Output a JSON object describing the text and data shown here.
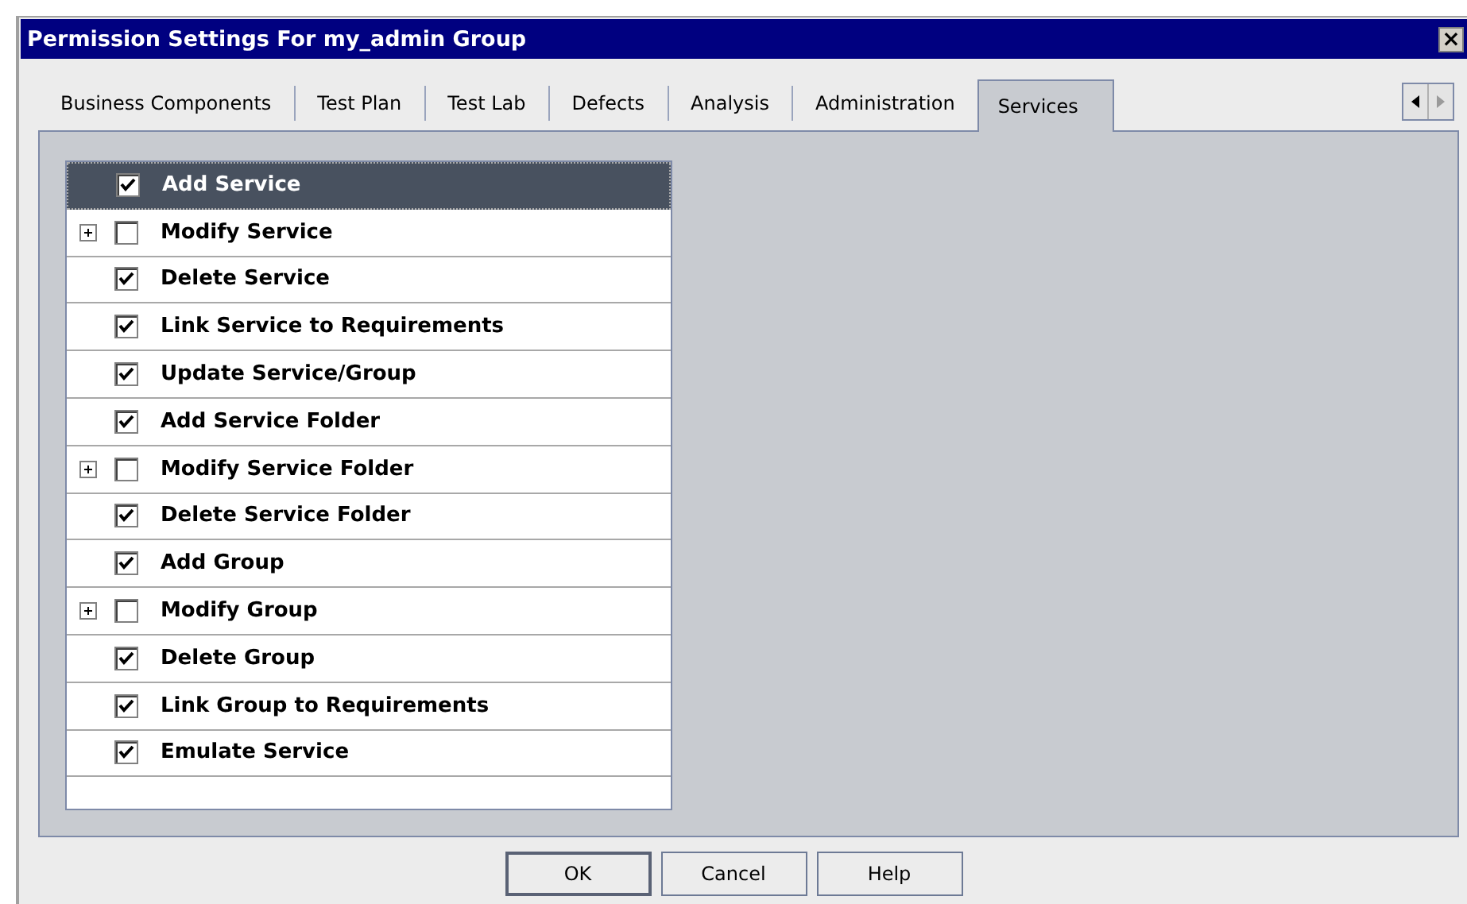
{
  "window": {
    "title": "Permission Settings For my_admin Group",
    "close": "×"
  },
  "tabs": [
    {
      "label": "Business Components",
      "selected": false
    },
    {
      "label": "Test Plan",
      "selected": false
    },
    {
      "label": "Test Lab",
      "selected": false
    },
    {
      "label": "Defects",
      "selected": false
    },
    {
      "label": "Analysis",
      "selected": false
    },
    {
      "label": "Administration",
      "selected": false
    },
    {
      "label": "Services",
      "selected": true
    }
  ],
  "permissions": [
    {
      "label": "Add Service",
      "checked": true,
      "selected": true
    },
    {
      "label": "Modify Service",
      "checked": false,
      "selected": false,
      "expanded": false
    },
    {
      "label": "Delete Service",
      "checked": true,
      "selected": false
    },
    {
      "label": "Link Service to Requirements",
      "checked": true,
      "selected": false
    },
    {
      "label": "Update Service/Group",
      "checked": true,
      "selected": false
    },
    {
      "label": "Add Service Folder",
      "checked": true,
      "selected": false
    },
    {
      "label": "Modify Service Folder",
      "checked": false,
      "selected": false,
      "expanded": false
    },
    {
      "label": "Delete Service Folder",
      "checked": true,
      "selected": false
    },
    {
      "label": "Add Group",
      "checked": true,
      "selected": false
    },
    {
      "label": "Modify Group",
      "checked": false,
      "selected": false,
      "expanded": false
    },
    {
      "label": "Delete Group",
      "checked": true,
      "selected": false
    },
    {
      "label": "Link Group to Requirements",
      "checked": true,
      "selected": false
    },
    {
      "label": "Emulate Service",
      "checked": true,
      "selected": false
    }
  ],
  "buttons": [
    "OK",
    "Cancel",
    "Help"
  ]
}
